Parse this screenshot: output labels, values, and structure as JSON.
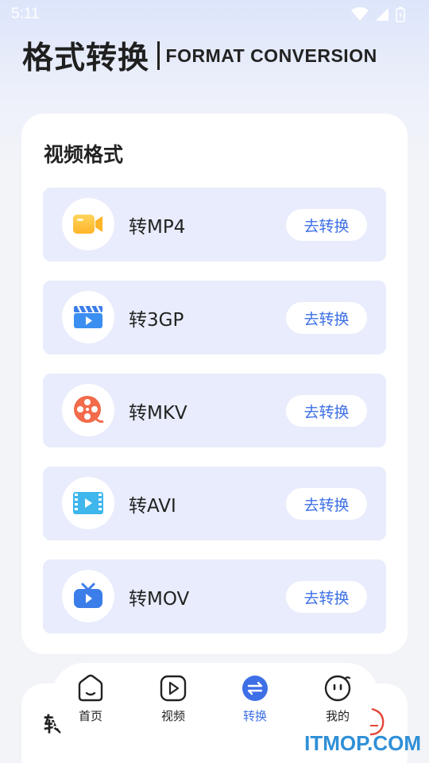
{
  "status_bar": {
    "time": "5:11"
  },
  "header": {
    "title_cn": "格式转换",
    "title_en": "FORMAT CONVERSION"
  },
  "video_section": {
    "title": "视频格式",
    "button_label": "去转换",
    "items": [
      {
        "label": "转MP4",
        "icon": "video-camera-icon"
      },
      {
        "label": "转3GP",
        "icon": "clapperboard-icon"
      },
      {
        "label": "转MKV",
        "icon": "film-reel-icon"
      },
      {
        "label": "转AVI",
        "icon": "film-strip-icon"
      },
      {
        "label": "转MOV",
        "icon": "tv-play-icon"
      }
    ]
  },
  "next_section": {
    "title": "转"
  },
  "tab_bar": {
    "active": "转换",
    "tabs": [
      {
        "label": "首页",
        "icon": "home-smile-icon"
      },
      {
        "label": "视频",
        "icon": "play-square-icon"
      },
      {
        "label": "转换",
        "icon": "swap-arrows-icon"
      },
      {
        "label": "我的",
        "icon": "face-profile-icon"
      }
    ]
  },
  "watermark": "ITMOP.COM",
  "colors": {
    "accent": "#3d6fe6",
    "row_bg": "#e8ecfc"
  }
}
